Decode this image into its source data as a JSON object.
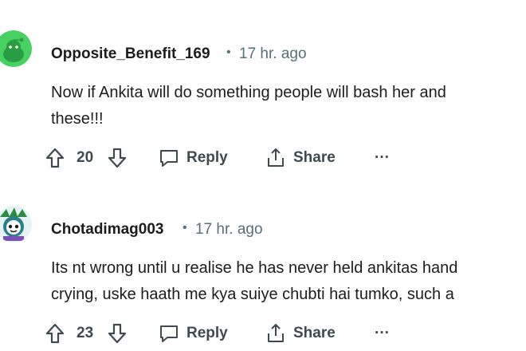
{
  "comments": [
    {
      "author": "Opposite_Benefit_169",
      "separator": "•",
      "time": "17 hr. ago",
      "text_lines": [
        "Now if Ankita will do something people will bash her and",
        "these!!!"
      ],
      "votes": "20",
      "reply_label": "Reply",
      "share_label": "Share",
      "more_label": "···",
      "avatar_icon": "reddit-snoo-avatar",
      "avatar_color": "#46d160"
    },
    {
      "author": "Chotadimag003",
      "separator": "•",
      "time": "17 hr. ago",
      "text_lines": [
        "Its nt wrong until u realise he has never held ankitas hand",
        "crying, uske haath me kya suiye chubti hai tumko, such a"
      ],
      "votes": "23",
      "reply_label": "Reply",
      "share_label": "Share",
      "more_label": "···",
      "avatar_icon": "custom-character-avatar",
      "avatar_color": "#2a7f8f"
    }
  ],
  "colors": {
    "text": "#1c1c1c",
    "meta": "#576f76",
    "action": "#3e4a50"
  }
}
